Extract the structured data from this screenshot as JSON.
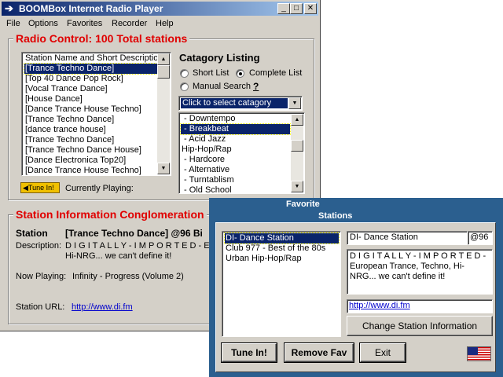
{
  "main_window": {
    "title": "BOOMBox Internet Radio Player",
    "menu": [
      "File",
      "Options",
      "Favorites",
      "Recorder",
      "Help"
    ],
    "radio_control_title": "Radio Control: 100 Total stations",
    "station_list_header": "Station Name and Short Description",
    "stations": [
      "[Trance Techno Dance]",
      "[Top 40 Dance Pop Rock]",
      "[Vocal Trance Dance]",
      "[House  Dance]",
      "[Dance Trance House Techno]",
      "[Trance Techno Dance]",
      "[dance trance house]",
      "[Trance Techno Dance]",
      "[Trance Techno Dance House]",
      "[Dance Electronica Top20]",
      "[Dance Trance House Techno]"
    ],
    "selected_station_index": 0,
    "category_title": "Catagory Listing",
    "short_list_label": "Short List",
    "complete_list_label": "Complete List",
    "manual_search_label": "Manual Search",
    "manual_search_help": "?",
    "category_select_placeholder": "Click to select catagory",
    "categories": [
      " - Downtempo",
      " - Breakbeat",
      " - Acid Jazz",
      "Hip-Hop/Rap",
      " - Hardcore",
      " - Alternative",
      " - Turntablism",
      " - Old School"
    ],
    "selected_category_index": 1,
    "tune_in_label": "Tune In!",
    "currently_playing_label": "Currently Playing:",
    "station_info_title": "Station Information Conglomeration",
    "station_label": "Station",
    "station_value": "[Trance Techno Dance] @96 Bi",
    "description_label": "Description:",
    "description_line1": "D I G I T A L L Y - I M P O R T E D - E",
    "description_line2": "Hi-NRG... we can't define it!",
    "now_playing_label": "Now Playing:",
    "now_playing_value": "Infinity - Progress (Volume 2)",
    "station_url_label": "Station URL:",
    "station_url_value": "http://www.di.fm"
  },
  "favorite_window": {
    "title_line1": "Favorite",
    "title_line2": "Stations",
    "favorites": [
      "DI- Dance Station",
      "Club 977 - Best of the 80s",
      "Urban Hip-Hop/Rap"
    ],
    "selected_favorite_index": 0,
    "name_value": "DI- Dance Station",
    "bitrate_value": "@96",
    "description_value": "D I G I T A L L Y - I M P O R T E D - European Trance, Techno, Hi-NRG... we can't define it!",
    "url_value": "http://www.di.fm",
    "change_info_label": "Change Station Information",
    "tune_in_label": "Tune In!",
    "remove_fav_label": "Remove Fav",
    "exit_label": "Exit",
    "flag_icon": "us-flag-icon"
  }
}
